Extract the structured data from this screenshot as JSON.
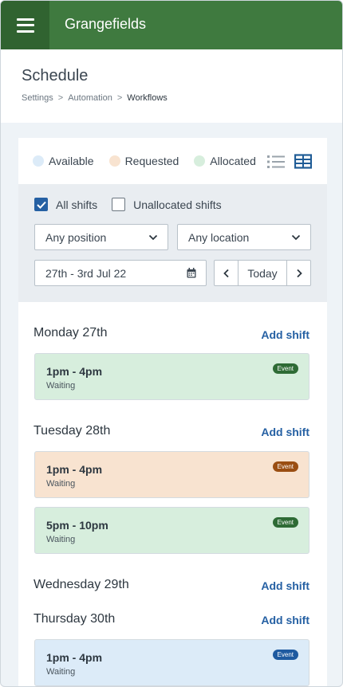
{
  "header": {
    "app_title": "Grangefields"
  },
  "page": {
    "title": "Schedule",
    "breadcrumb": [
      "Settings",
      "Automation",
      "Workflows"
    ],
    "breadcrumb_sep": ">"
  },
  "legend": {
    "items": [
      {
        "label": "Available",
        "color": "#dcebf8"
      },
      {
        "label": "Requested",
        "color": "#f8e3d0"
      },
      {
        "label": "Allocated",
        "color": "#d7eedd"
      }
    ]
  },
  "filters": {
    "all_shifts": "All shifts",
    "unallocated_shifts": "Unallocated shifts",
    "all_shifts_checked": true,
    "unallocated_checked": false,
    "position": "Any position",
    "location": "Any location",
    "date_range": "27th - 3rd Jul 22",
    "today": "Today"
  },
  "days": [
    {
      "label": "Monday 27th",
      "add": "Add shift",
      "shifts": [
        {
          "time": "1pm - 4pm",
          "status": "Waiting",
          "badge": "Event",
          "kind": "allocated"
        }
      ]
    },
    {
      "label": "Tuesday 28th",
      "add": "Add shift",
      "shifts": [
        {
          "time": "1pm - 4pm",
          "status": "Waiting",
          "badge": "Event",
          "kind": "requested"
        },
        {
          "time": "5pm - 10pm",
          "status": "Waiting",
          "badge": "Event",
          "kind": "allocated"
        }
      ]
    },
    {
      "label": "Wednesday 29th",
      "add": "Add shift",
      "shifts": []
    },
    {
      "label": "Thursday 30th",
      "add": "Add shift",
      "shifts": [
        {
          "time": "1pm - 4pm",
          "status": "Waiting",
          "badge": "Event",
          "kind": "available"
        }
      ]
    }
  ],
  "colors": {
    "header": "#3f7a3f",
    "accent": "#2560a3",
    "allocated_bg": "#d7eedd",
    "allocated_badge": "#2e6b35",
    "requested_bg": "#f8e3d0",
    "requested_badge": "#9a4e12",
    "available_bg": "#dcebf8",
    "available_badge": "#1e5aa0"
  }
}
